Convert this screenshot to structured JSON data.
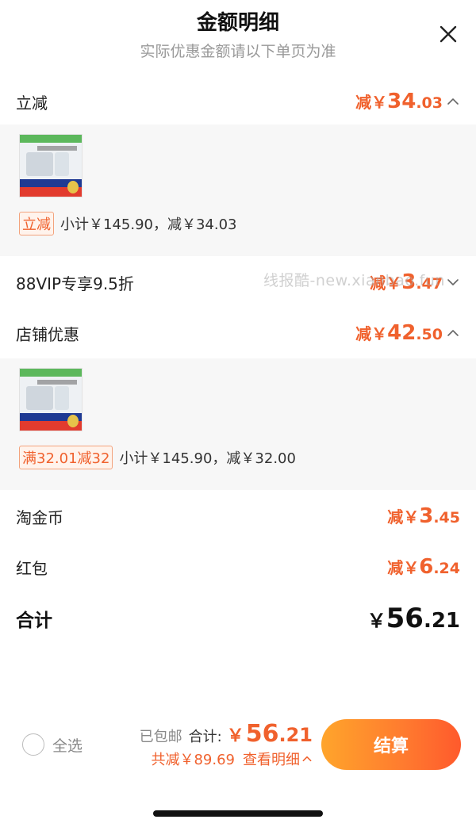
{
  "header": {
    "title": "金额明细",
    "subtitle": "实际优惠金额请以下单页为准"
  },
  "sections": [
    {
      "label": "立减",
      "amount_prefix": "减￥",
      "amount_int": "34",
      "amount_dec": ".03",
      "expanded": true,
      "detail": {
        "tag": "立减",
        "text": "小计￥145.90，减￥34.03"
      }
    },
    {
      "label": "88VIP专享9.5折",
      "amount_prefix": "减￥",
      "amount_int": "3",
      "amount_dec": ".47",
      "expanded": false
    },
    {
      "label": "店铺优惠",
      "amount_prefix": "减￥",
      "amount_int": "42",
      "amount_dec": ".50",
      "expanded": true,
      "detail": {
        "tag": "满32.01减32",
        "text": "小计￥145.90，减￥32.00"
      }
    },
    {
      "label": "淘金币",
      "amount_prefix": "减￥",
      "amount_int": "3",
      "amount_dec": ".45"
    },
    {
      "label": "红包",
      "amount_prefix": "减￥",
      "amount_int": "6",
      "amount_dec": ".24"
    }
  ],
  "total": {
    "label": "合计",
    "symbol": "￥",
    "int": "56",
    "dec": ".21"
  },
  "watermark": "线报酷-new.xianbao.fun",
  "bottom_bar": {
    "select_all_label": "全选",
    "free_shipping": "已包邮",
    "sum_label": "合计:",
    "sum_symbol": "￥",
    "sum_int": "56",
    "sum_dec": ".21",
    "saved_text": "共减￥89.69",
    "view_detail_label": "查看明细",
    "checkout_label": "结算"
  },
  "colors": {
    "accent": "#f0612d",
    "panel_bg": "#f7f7f7",
    "checkout_gradient_start": "#ffa52b",
    "checkout_gradient_end": "#ff5a2c"
  },
  "icons": {
    "close": "close-icon",
    "chevron_up": "chevron-up-icon",
    "chevron_down": "chevron-down-icon"
  }
}
